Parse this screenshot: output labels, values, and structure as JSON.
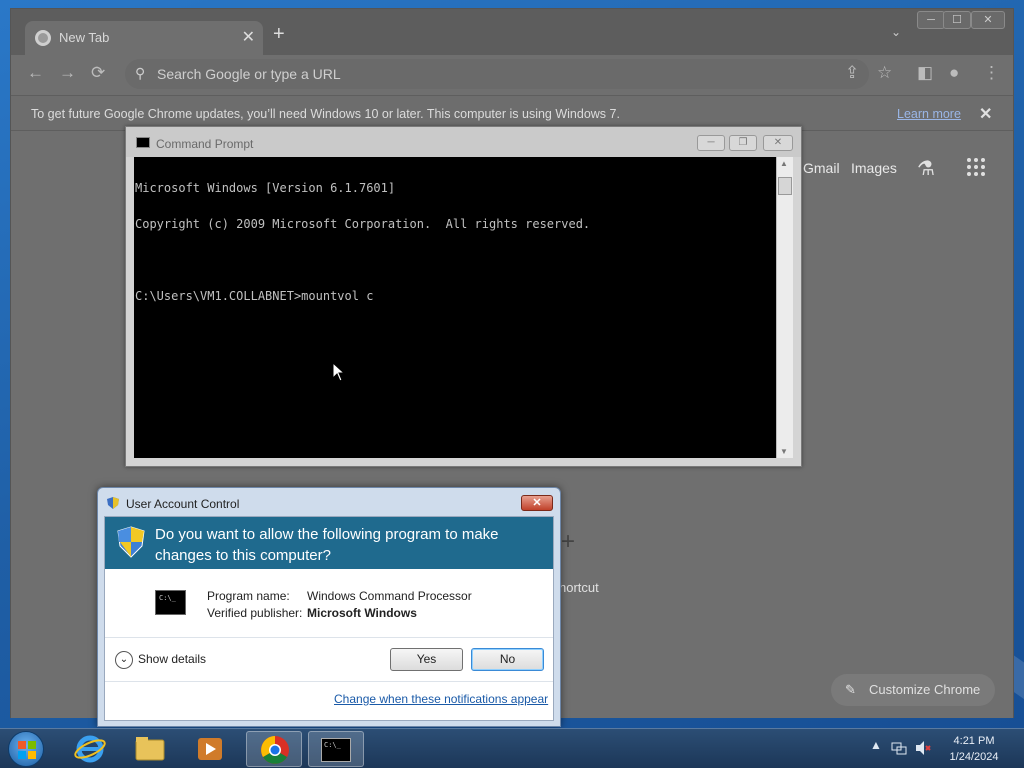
{
  "chrome": {
    "tab_title": "New Tab",
    "tab_close": "✕",
    "new_tab": "+",
    "omnibox_placeholder": "Search Google or type a URL",
    "infobar_message": "To get future Google Chrome updates, you’ll need Windows 10 or later. This computer is using Windows 7.",
    "infobar_link": "Learn more",
    "infobar_close": "✕",
    "gmail": "Gmail",
    "images": "Images",
    "shortcut_plus": "+",
    "shortcut_label": "hortcut",
    "customize_label": "Customize Chrome",
    "icons": {
      "back": "←",
      "forward": "→",
      "reload": "⟳",
      "search": "⚲",
      "share": "⇪",
      "star": "☆",
      "sidepanel": "◧",
      "profile": "●",
      "menu": "⋮",
      "flask": "⚗",
      "pencil": "✎",
      "minimize": "─",
      "maximize": "☐",
      "close": "✕",
      "tabs_dropdown": "⌄"
    }
  },
  "cmd": {
    "title": "Command Prompt",
    "lines": [
      "Microsoft Windows [Version 6.1.7601]",
      "Copyright (c) 2009 Microsoft Corporation.  All rights reserved.",
      "",
      "C:\\Users\\VM1.COLLABNET>mountvol c"
    ],
    "btn_min": "─",
    "btn_max": "❐",
    "btn_close": "✕"
  },
  "uac": {
    "title": "User Account Control",
    "close": "✕",
    "question": "Do you want to allow the following program to make changes to this computer?",
    "program_icon_text": "C:\\_",
    "program_name_label": "Program name:",
    "program_name_value": "Windows Command Processor",
    "publisher_label": "Verified publisher:",
    "publisher_value": "Microsoft Windows",
    "show_details": "Show details",
    "yes": "Yes",
    "no": "No",
    "change_link": "Change when these notifications appear"
  },
  "taskbar": {
    "cmd_icon_text": "C:\\_",
    "clock_time": "4:21 PM",
    "clock_date": "1/24/2024",
    "tray_arrow": "▲"
  }
}
